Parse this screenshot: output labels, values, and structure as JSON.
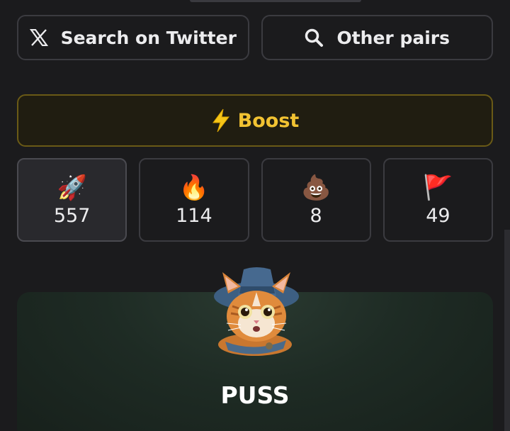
{
  "links": {
    "twitter": {
      "label": "Search on Twitter",
      "icon": "x-logo-icon"
    },
    "pairs": {
      "label": "Other pairs",
      "icon": "search-icon"
    }
  },
  "boost": {
    "label": "Boost",
    "icon": "lightning-icon",
    "color": "#f1c232"
  },
  "reactions": [
    {
      "emoji": "🚀",
      "icon": "rocket-icon",
      "count": "557",
      "active": true
    },
    {
      "emoji": "🔥",
      "icon": "fire-icon",
      "count": "114",
      "active": false
    },
    {
      "emoji": "💩",
      "icon": "poop-icon",
      "count": "8",
      "active": false
    },
    {
      "emoji": "🚩",
      "icon": "red-flag-icon",
      "count": "49",
      "active": false
    }
  ],
  "token": {
    "name": "PUSS",
    "avatar": "cat-wizard-avatar"
  },
  "colors": {
    "background": "#1b1b1d",
    "accent": "#f1c232",
    "card": "#1e2b24"
  }
}
